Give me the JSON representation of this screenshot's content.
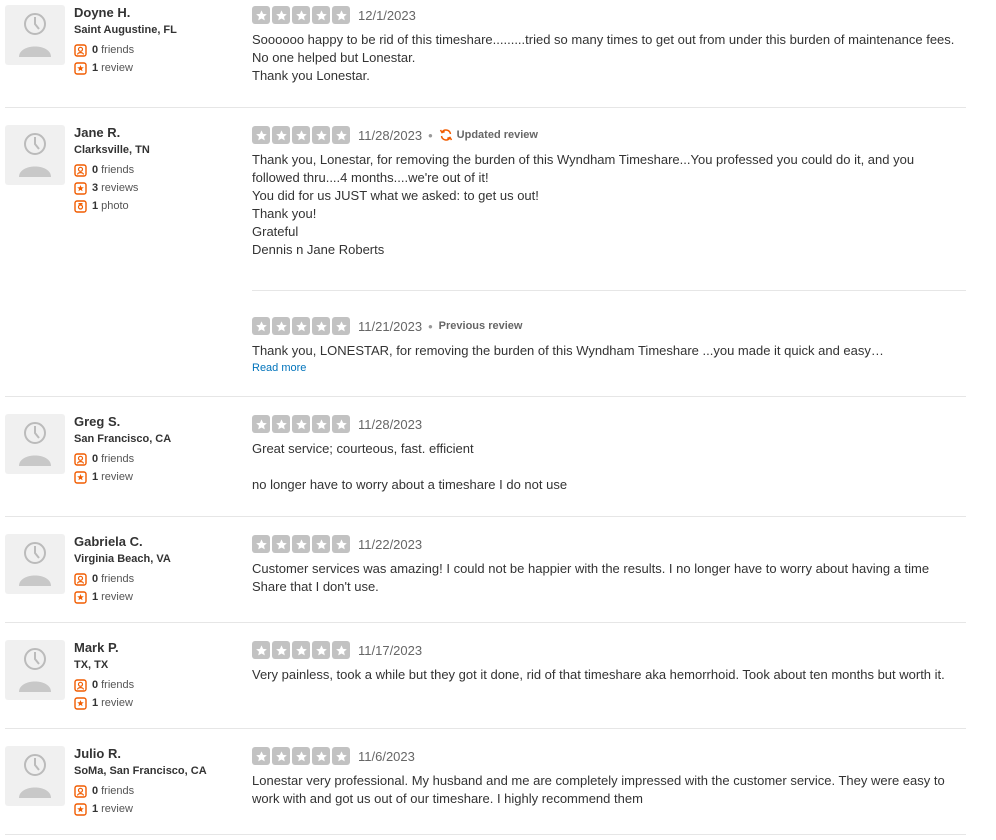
{
  "colors": {
    "accent": "#d32323",
    "icon_orange": "#f15c00",
    "link": "#0073bb",
    "star_bg": "#c2c2c2"
  },
  "reviews": [
    {
      "name": "Doyne H.",
      "location": "Saint Augustine, FL",
      "friends": "0",
      "friends_label": "friends",
      "reviews": "1",
      "reviews_label": "review",
      "rating": 5,
      "date": "12/1/2023",
      "text": "Soooooo happy to be rid of this timeshare.........tried so many times to get out from under this burden of maintenance fees.  No one helped but Lonestar.\nThank you Lonestar."
    },
    {
      "name": "Jane R.",
      "location": "Clarksville, TN",
      "friends": "0",
      "friends_label": "friends",
      "reviews": "3",
      "reviews_label": "reviews",
      "photos": "1",
      "photos_label": "photo",
      "rating": 5,
      "date": "11/28/2023",
      "updated_label": "Updated review",
      "text": "Thank you, Lonestar, for removing the burden of this Wyndham Timeshare...You professed you could do it, and you followed thru....4 months....we're out of it!\nYou did for us JUST what we asked: to get us out!\nThank you!\nGrateful\nDennis n Jane Roberts",
      "previous": {
        "rating": 5,
        "date": "11/21/2023",
        "label": "Previous review",
        "text": "Thank you, LONESTAR, for removing the burden of this Wyndham Timeshare ...you made it quick and easy…",
        "read_more": "Read more"
      }
    },
    {
      "name": "Greg S.",
      "location": "San Francisco, CA",
      "friends": "0",
      "friends_label": "friends",
      "reviews": "1",
      "reviews_label": "review",
      "rating": 5,
      "date": "11/28/2023",
      "text": "Great service; courteous, fast.  efficient\n\nno longer have to worry about a timeshare I do not use"
    },
    {
      "name": "Gabriela C.",
      "location": "Virginia Beach, VA",
      "friends": "0",
      "friends_label": "friends",
      "reviews": "1",
      "reviews_label": "review",
      "rating": 5,
      "date": "11/22/2023",
      "text": "Customer services was amazing! I could not be happier with the results. I no longer have to worry about having a time Share that I don't use."
    },
    {
      "name": "Mark P.",
      "location": "TX, TX",
      "friends": "0",
      "friends_label": "friends",
      "reviews": "1",
      "reviews_label": "review",
      "rating": 5,
      "date": "11/17/2023",
      "text": "Very painless, took a while but they got it done, rid of that timeshare aka hemorrhoid. Took about ten months but worth it."
    },
    {
      "name": "Julio R.",
      "location": "SoMa, San Francisco, CA",
      "friends": "0",
      "friends_label": "friends",
      "reviews": "1",
      "reviews_label": "review",
      "rating": 5,
      "date": "11/6/2023",
      "text": "Lonestar very professional. My husband and me are completely impressed with the customer service. They were easy to work with and got us out of our timeshare. I highly recommend them"
    }
  ]
}
